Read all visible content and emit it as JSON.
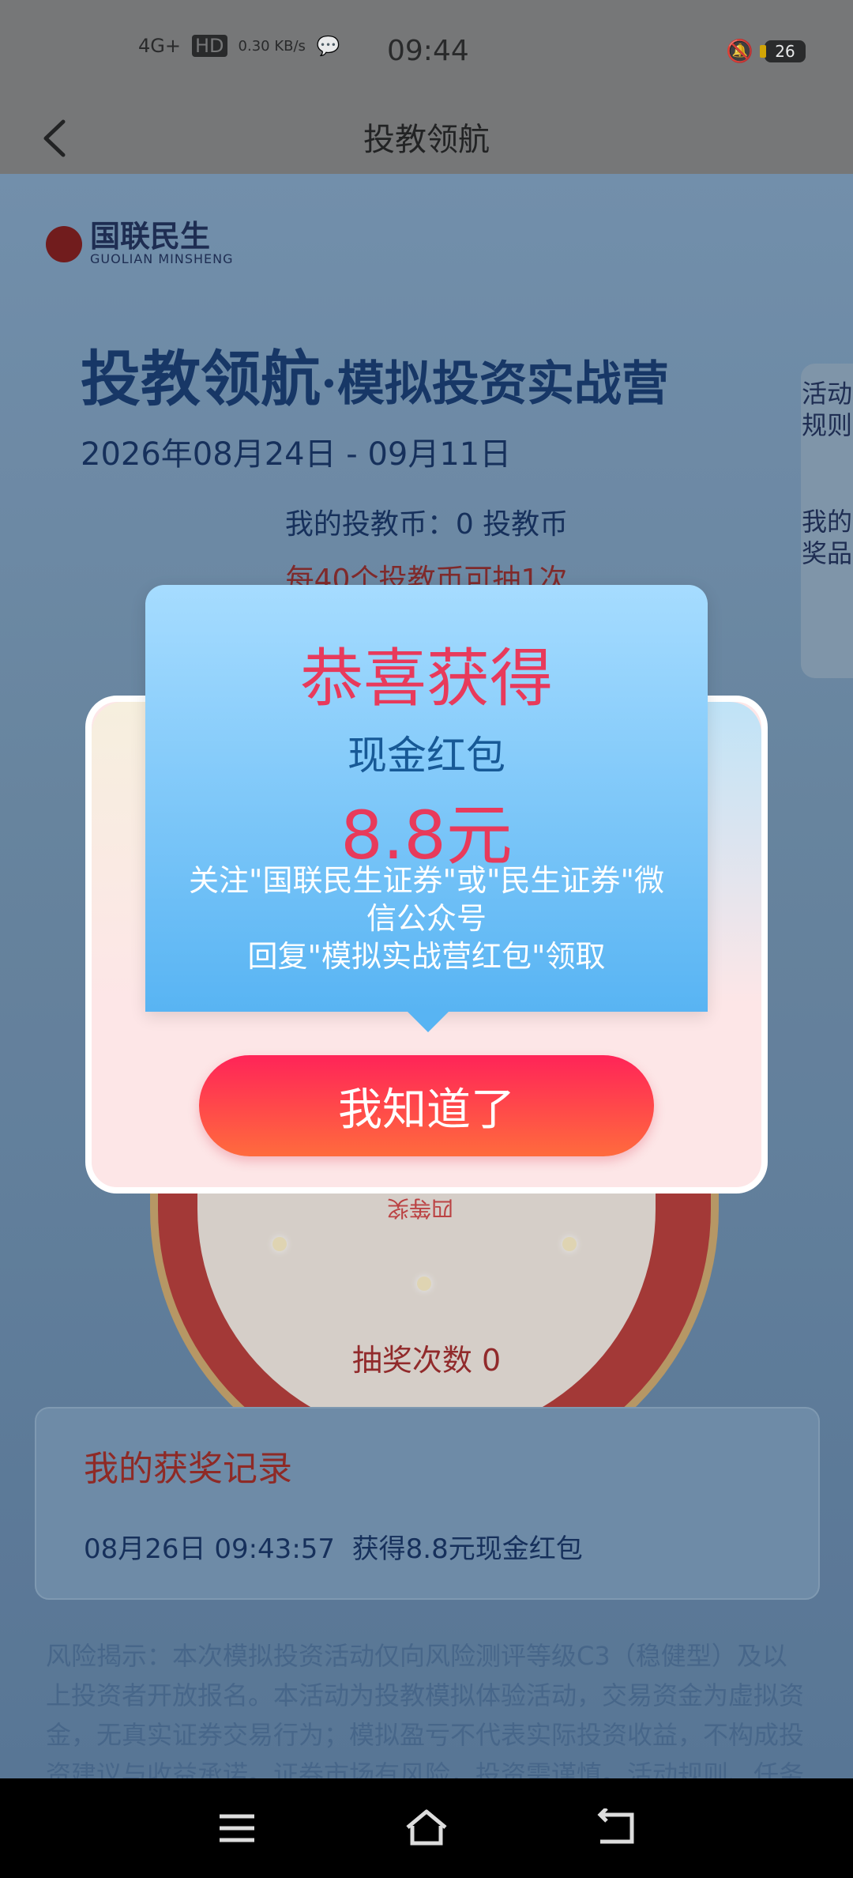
{
  "status": {
    "network": "4G+",
    "hd": "HD",
    "speed": "0.30 KB/s",
    "time": "09:44",
    "battery": "26"
  },
  "header": {
    "title": "投教领航"
  },
  "brand": {
    "cn": "国联民生",
    "en": "GUOLIAN MINSHENG"
  },
  "campaign": {
    "title_main": "投教领航",
    "title_rest": "·模拟投资实战营",
    "date": "2026年08月24日 - 09月11日",
    "coins": "我的投教币：0 投教币",
    "per_draw": "每40个投教币可抽1次"
  },
  "side_tabs": {
    "rules": "活动规则",
    "prizes": "我的奖品"
  },
  "wheel": {
    "prize_label": "四等奖"
  },
  "draws": "抽奖次数 0",
  "record": {
    "heading": "我的获奖记录",
    "items": [
      {
        "time": "08月26日 09:43:57",
        "text": "获得8.8元现金红包"
      }
    ]
  },
  "risk": "风险揭示：本次模拟投资活动仅向风险测评等级C3（稳健型）及以上投资者开放报名。本活动为投教模拟体验活动，交易资金为虚拟资金，无真实证券交易行为；模拟盈亏不代表实际投资收益，不构成投资建议与收益承诺。证券市场有风险，投资需谨慎。活动规则、任务",
  "modal": {
    "title": "恭喜获得",
    "prize_type": "现金红包",
    "amount": "8.8元",
    "note_1": "关注\"国联民生证券\"或\"民生证券\"微",
    "note_2": "信公众号",
    "note_3": "回复\"模拟实战营红包\"领取",
    "button": "我知道了"
  }
}
